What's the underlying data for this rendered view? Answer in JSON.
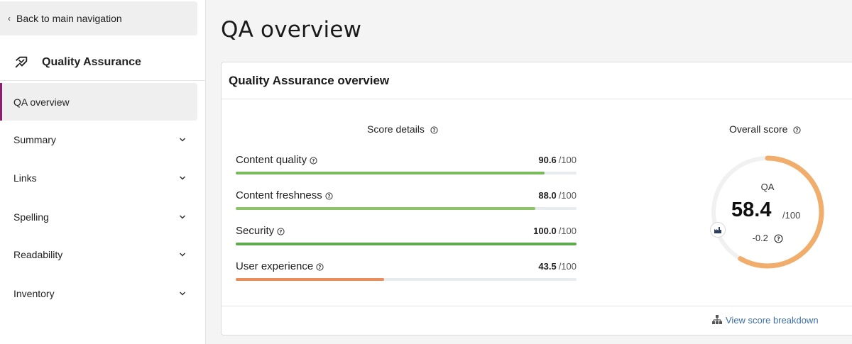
{
  "sidebar": {
    "back_label": "Back to main navigation",
    "section_title": "Quality Assurance",
    "active_item": "QA overview",
    "items": [
      {
        "label": "Summary"
      },
      {
        "label": "Links"
      },
      {
        "label": "Spelling"
      },
      {
        "label": "Readability"
      },
      {
        "label": "Inventory"
      }
    ]
  },
  "page": {
    "title": "QA overview"
  },
  "card": {
    "title": "Quality Assurance overview",
    "score_details_title": "Score details",
    "metrics": [
      {
        "label": "Content quality",
        "value": "90.6",
        "max": "/100",
        "fraction": 0.906,
        "color": "#7aba5c"
      },
      {
        "label": "Content freshness",
        "value": "88.0",
        "max": "/100",
        "fraction": 0.88,
        "color": "#8cc46a"
      },
      {
        "label": "Security",
        "value": "100.0",
        "max": "/100",
        "fraction": 1.0,
        "color": "#5fa94f"
      },
      {
        "label": "User experience",
        "value": "43.5",
        "max": "/100",
        "fraction": 0.435,
        "color": "#e98d5c"
      }
    ],
    "overall": {
      "title": "Overall score",
      "label": "QA",
      "score": "58.4",
      "max": "/100",
      "delta": "-0.2",
      "fraction": 0.584,
      "color": "#f0ad6b"
    },
    "footer_link": "View score breakdown"
  },
  "colors": {
    "accent": "#8b2070",
    "link": "#3d6fa8"
  }
}
